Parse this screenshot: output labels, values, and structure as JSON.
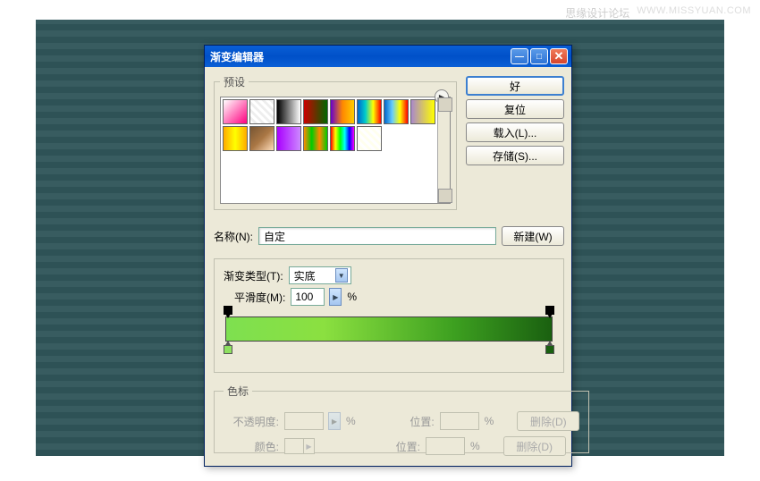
{
  "watermark": {
    "site": "思缘设计论坛",
    "url": "WWW.MISSYUAN.COM"
  },
  "titlebar": {
    "title": "渐变编辑器"
  },
  "sideButtons": {
    "ok": "好",
    "cancel": "复位",
    "load": "载入(L)...",
    "save": "存储(S)..."
  },
  "presets": {
    "legend": "预设"
  },
  "nameRow": {
    "label": "名称(N):",
    "value": "自定",
    "newBtn": "新建(W)"
  },
  "editor": {
    "typeLabel": "渐变类型(T):",
    "typeValue": "实底",
    "smoothLabel": "平滑度(M):",
    "smoothValue": "100",
    "percent": "%"
  },
  "stops": {
    "legend": "色标",
    "opacityLabel": "不透明度:",
    "colorLabel": "颜色:",
    "positionLabel": "位置:",
    "percent": "%",
    "deleteBtn": "删除(D)"
  }
}
